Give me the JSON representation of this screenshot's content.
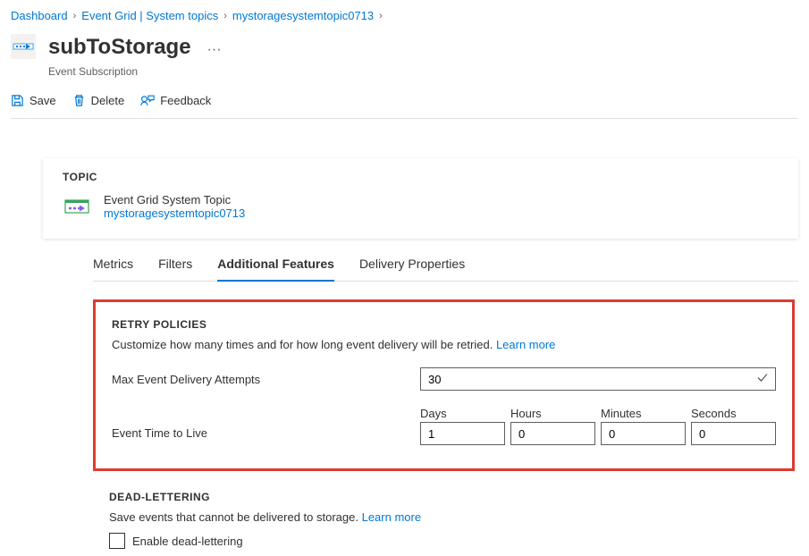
{
  "breadcrumb": {
    "items": [
      "Dashboard",
      "Event Grid | System topics",
      "mystoragesystemtopic0713"
    ]
  },
  "header": {
    "title": "subToStorage",
    "subtitle": "Event Subscription",
    "ellipsis": "···"
  },
  "toolbar": {
    "save": "Save",
    "delete": "Delete",
    "feedback": "Feedback"
  },
  "topic": {
    "label": "TOPIC",
    "name": "Event Grid System Topic",
    "link": "mystoragesystemtopic0713"
  },
  "tabs": {
    "metrics": "Metrics",
    "filters": "Filters",
    "additional": "Additional Features",
    "delivery": "Delivery Properties"
  },
  "retry": {
    "heading": "RETRY POLICIES",
    "desc": "Customize how many times and for how long event delivery will be retried.",
    "learn_more": "Learn more",
    "max_label": "Max Event Delivery Attempts",
    "max_value": "30",
    "ttl_label": "Event Time to Live",
    "days_label": "Days",
    "hours_label": "Hours",
    "minutes_label": "Minutes",
    "seconds_label": "Seconds",
    "days_value": "1",
    "hours_value": "0",
    "minutes_value": "0",
    "seconds_value": "0"
  },
  "dead": {
    "heading": "DEAD-LETTERING",
    "desc": "Save events that cannot be delivered to storage.",
    "learn_more": "Learn more",
    "checkbox_label": "Enable dead-lettering"
  }
}
